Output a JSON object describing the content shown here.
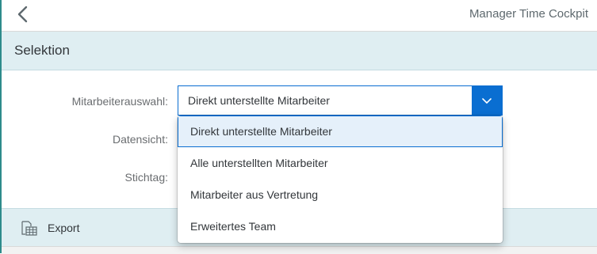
{
  "header": {
    "back_icon": "chevron-left-icon",
    "title": "Manager Time Cockpit"
  },
  "section": {
    "title": "Selektion"
  },
  "form": {
    "labels": {
      "mitarbeiterauswahl": "Mitarbeiterauswahl:",
      "datensicht": "Datensicht:",
      "stichtag": "Stichtag:"
    },
    "mitarbeiter_select": {
      "value": "Direkt unterstellte Mitarbeiter",
      "arrow_icon": "chevron-down-icon"
    }
  },
  "dropdown": {
    "options": [
      "Direkt unterstellte Mitarbeiter",
      "Alle unterstellten Mitarbeiter",
      "Mitarbeiter aus Vertretung",
      "Erweitertes Team"
    ],
    "selected_index": 0
  },
  "footer": {
    "export_label": "Export",
    "export_icon": "spreadsheet-export-icon"
  },
  "colors": {
    "accent": "#0a6ed1",
    "section_bg": "#dfeef2",
    "left_accent": "#2e8b8b"
  }
}
